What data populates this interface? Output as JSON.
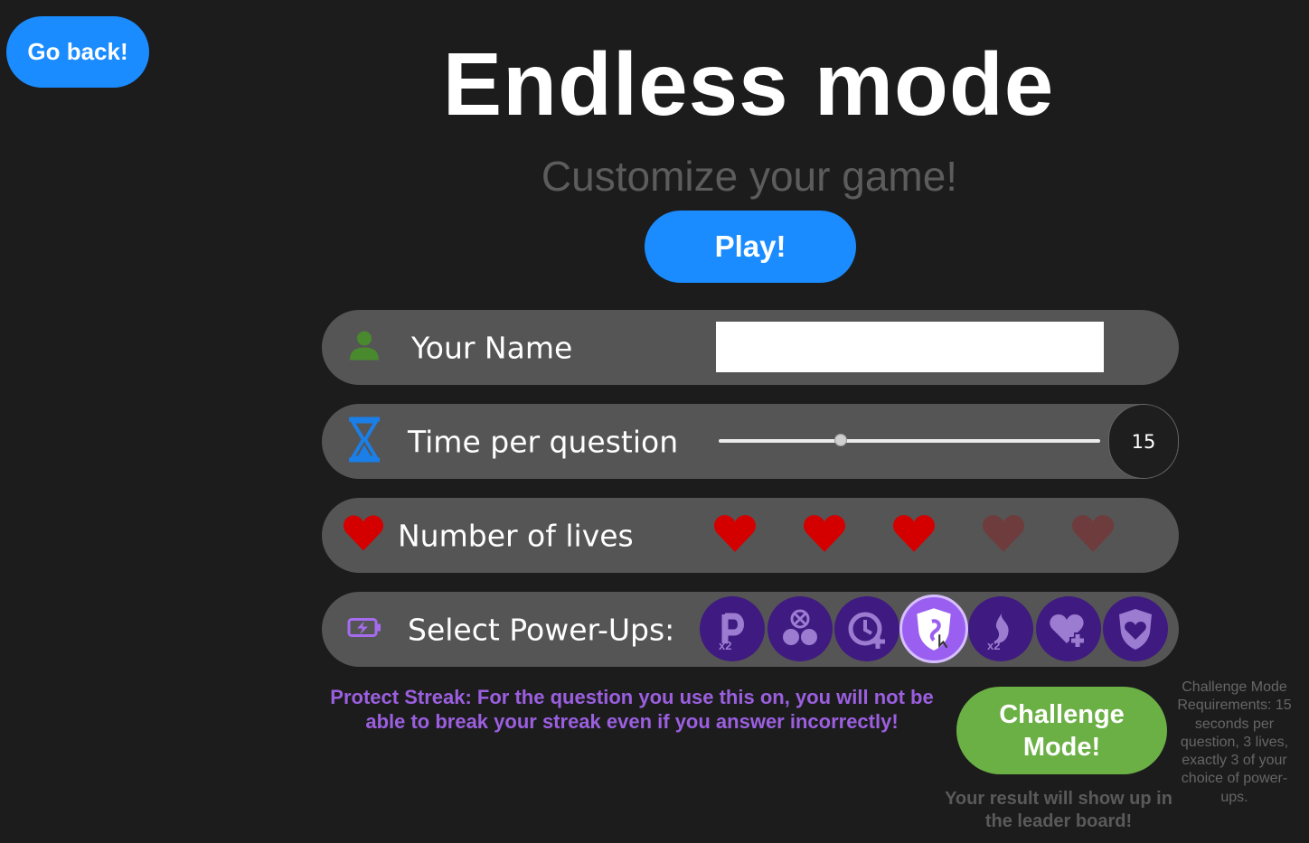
{
  "nav": {
    "back_label": "Go back!"
  },
  "header": {
    "title": "Endless mode",
    "subtitle": "Customize your game!"
  },
  "play": {
    "label": "Play!"
  },
  "settings": {
    "name": {
      "label": "Your Name",
      "value": "",
      "icon": "user-icon"
    },
    "time": {
      "label": "Time per question",
      "value": "15",
      "slider_fraction": 0.32,
      "icon": "hourglass-icon"
    },
    "lives": {
      "label": "Number of lives",
      "selected": 3,
      "max": 5,
      "icon": "heart-icon"
    },
    "powerups": {
      "label": "Select Power-Ups:",
      "icon": "battery-charging-icon",
      "items": [
        {
          "name": "double-points",
          "badge": "x2",
          "selected": false
        },
        {
          "name": "fifty-fifty",
          "selected": false
        },
        {
          "name": "extra-time",
          "selected": false
        },
        {
          "name": "protect-streak",
          "selected": true
        },
        {
          "name": "double-streak",
          "badge": "x2",
          "selected": false
        },
        {
          "name": "extra-life",
          "selected": false
        },
        {
          "name": "shield",
          "selected": false
        }
      ]
    }
  },
  "powerup_description": "Protect Streak: For the question you use this on, you will not be able to break your streak even if you answer incorrectly!",
  "challenge": {
    "label": "Challenge Mode!",
    "leaderboard_note": "Your result will show up in the leader board!",
    "requirements": "Challenge Mode Requirements: 15 seconds per question, 3 lives, exactly 3 of your choice of power-ups."
  },
  "colors": {
    "accent_blue": "#1a8cff",
    "challenge_green": "#6bb045",
    "powerup_purple": "#3f1a80",
    "description_purple": "#9b5fe0",
    "heart_red": "#d40000",
    "heart_dim": "#6e3c3c"
  }
}
